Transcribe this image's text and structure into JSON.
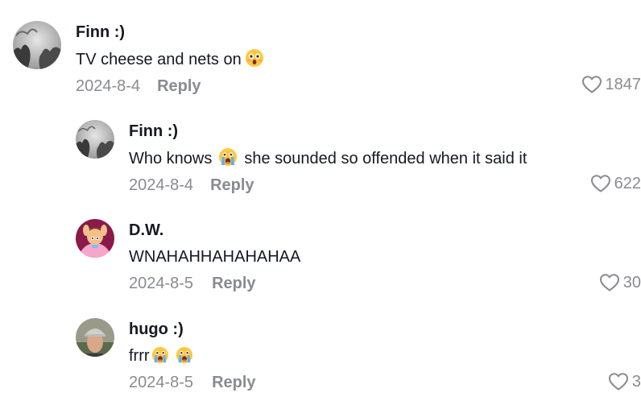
{
  "comments": [
    {
      "username": "Finn :)",
      "text_before": "TV cheese and nets on",
      "text_after": "",
      "emoji": "astonished-face-emoji",
      "date": "2024-8-4",
      "reply_label": "Reply",
      "likes": "1847",
      "avatar": "tree-silhouette-avatar"
    },
    {
      "username": "Finn :)",
      "text_before": "Who knows",
      "text_after": "she sounded so offended when it said it",
      "emoji": "crying-face-emoji",
      "date": "2024-8-4",
      "reply_label": "Reply",
      "likes": "622",
      "avatar": "tree-silhouette-avatar"
    },
    {
      "username": "D.W.",
      "text_before": "WNAHAHHAHAHAHAA",
      "text_after": "",
      "date": "2024-8-5",
      "reply_label": "Reply",
      "likes": "30",
      "avatar": "cartoon-character-avatar"
    },
    {
      "username": "hugo :)",
      "text_before": "frrr",
      "text_after": "",
      "emoji": "crying-face-emoji",
      "date": "2024-8-5",
      "reply_label": "Reply",
      "likes": "3",
      "avatar": "person-photo-avatar"
    }
  ],
  "colors": {
    "text": "#161823",
    "muted": "#8a8b91",
    "background": "#ffffff"
  },
  "icons": {
    "like": "heart-outline-icon"
  }
}
